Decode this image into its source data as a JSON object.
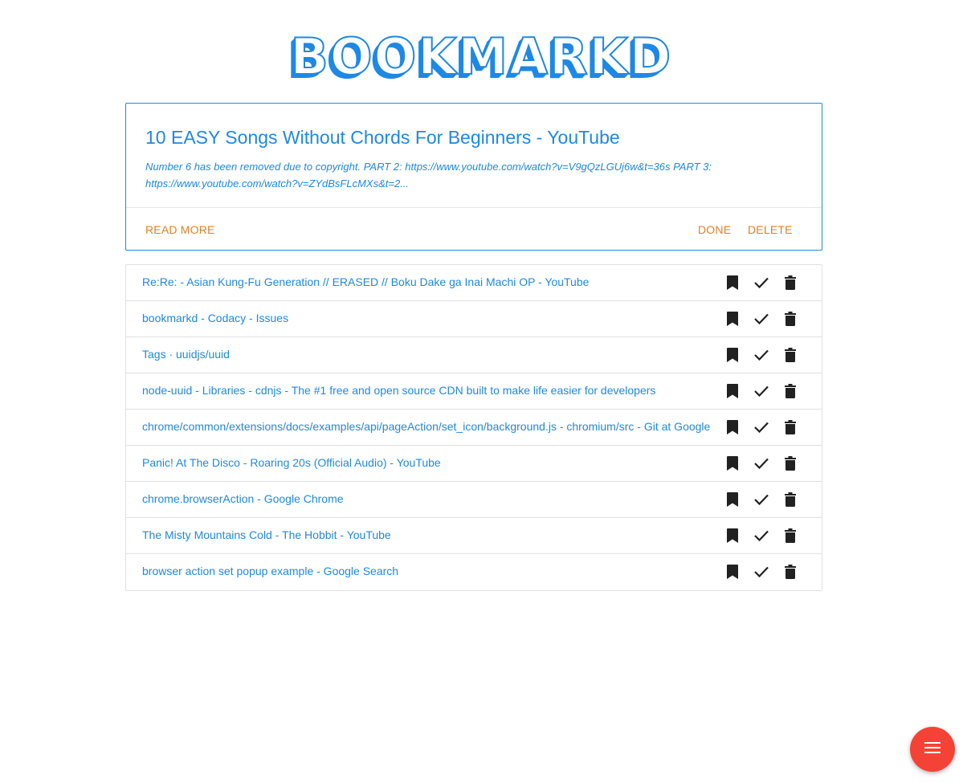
{
  "logo": {
    "text": "BOOKMARKD"
  },
  "featured": {
    "title": "10 EASY Songs Without Chords For Beginners - YouTube",
    "description": "Number 6 has been removed due to copyright. PART 2: https://www.youtube.com/watch?v=V9gQzLGUj6w&t=36s PART 3: https://www.youtube.com/watch?v=ZYdBsFLcMXs&t=2...",
    "read_more_label": "READ MORE",
    "done_label": "DONE",
    "delete_label": "DELETE"
  },
  "bookmarks": [
    {
      "title": "Re:Re: - Asian Kung-Fu Generation // ERASED // Boku Dake ga Inai Machi OP - YouTube"
    },
    {
      "title": "bookmarkd - Codacy - Issues"
    },
    {
      "title": "Tags · uuidjs/uuid"
    },
    {
      "title": "node-uuid - Libraries - cdnjs - The #1 free and open source CDN built to make life easier for developers"
    },
    {
      "title": "chrome/common/extensions/docs/examples/api/pageAction/set_icon/background.js - chromium/src - Git at Google"
    },
    {
      "title": "Panic! At The Disco - Roaring 20s (Official Audio) - YouTube"
    },
    {
      "title": "chrome.browserAction - Google Chrome"
    },
    {
      "title": "The Misty Mountains Cold - The Hobbit - YouTube"
    },
    {
      "title": "browser action set popup example - Google Search"
    }
  ],
  "icons": {
    "bookmark": "bookmark-icon",
    "done": "check-icon",
    "delete": "trash-icon",
    "menu": "menu-icon"
  },
  "colors": {
    "primary": "#1e88e5",
    "action": "#e67e22",
    "fab": "#f44336"
  }
}
